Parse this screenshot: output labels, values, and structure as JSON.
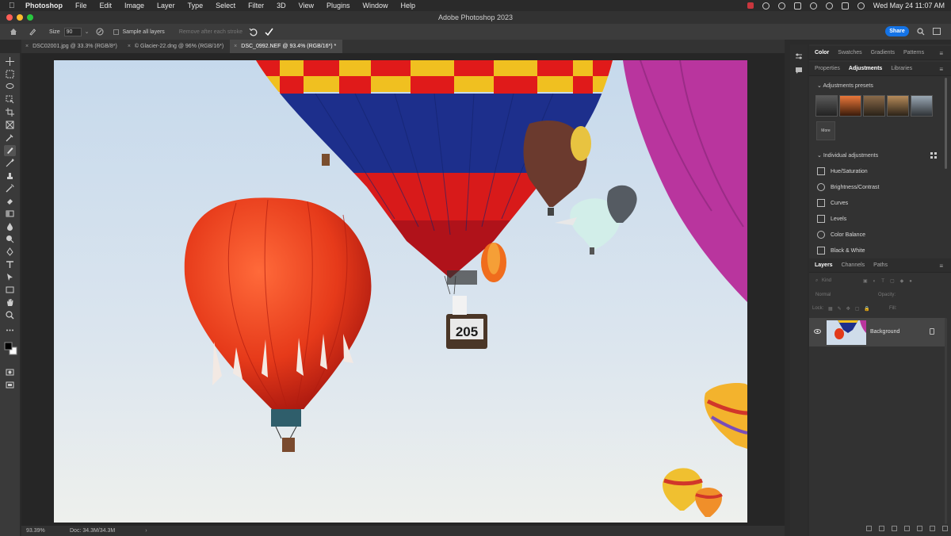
{
  "menu_bar": {
    "items": [
      "Photoshop",
      "File",
      "Edit",
      "Image",
      "Layer",
      "Type",
      "Select",
      "Filter",
      "3D",
      "View",
      "Plugins",
      "Window",
      "Help"
    ],
    "clock": "Wed May 24  11:07 AM"
  },
  "window": {
    "title": "Adobe Photoshop 2023"
  },
  "options_bar": {
    "size_label": "Size",
    "size_value": "90",
    "sample_all_layers": "Sample all layers",
    "remove_after_each_stroke": "Remove after each stroke",
    "share_label": "Share"
  },
  "doc_tabs": [
    {
      "label": "DSC02001.jpg @ 33.3% (RGB/8*)",
      "active": false
    },
    {
      "label": "© Glacier-22.dng @ 96% (RGB/16*)",
      "active": false
    },
    {
      "label": "DSC_0992.NEF @ 93.4% (RGB/16*) *",
      "active": true
    }
  ],
  "status_bar": {
    "zoom": "93.39%",
    "doc": "Doc: 34.3M/34.3M",
    "arrow": "›"
  },
  "panel_tabs_top": {
    "items": [
      "Color",
      "Swatches",
      "Gradients",
      "Patterns"
    ],
    "active": "Color"
  },
  "panel_tabs_mid": {
    "items": [
      "Properties",
      "Adjustments",
      "Libraries"
    ],
    "active": "Adjustments"
  },
  "adjustments": {
    "presets_header": "Adjustments presets",
    "more_label": "More",
    "individual_header": "Individual adjustments",
    "items": [
      "Hue/Saturation",
      "Brightness/Contrast",
      "Curves",
      "Levels",
      "Color Balance",
      "Black & White"
    ]
  },
  "layers_tabs": {
    "items": [
      "Layers",
      "Channels",
      "Paths"
    ],
    "active": "Layers"
  },
  "layers": {
    "kind_label": "Kind",
    "blend_mode": "Normal",
    "opacity_label": "Opacity:",
    "lock_label": "Lock:",
    "fill_label": "Fill:",
    "items": [
      {
        "name": "Background"
      }
    ]
  },
  "canvas_text": {
    "basket_number": "205"
  }
}
